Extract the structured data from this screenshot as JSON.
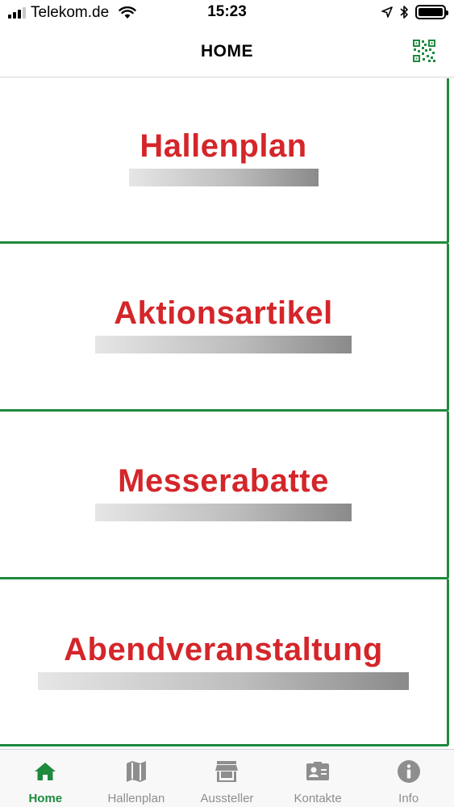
{
  "status_bar": {
    "carrier": "Telekom.de",
    "time": "15:23",
    "battery_level": 1.0
  },
  "nav": {
    "title": "HOME",
    "qr_icon": "qr-code-icon"
  },
  "colors": {
    "accent_green": "#1e8a3e",
    "tile_text_red": "#d4262a",
    "tab_inactive": "#8e8e8e"
  },
  "tiles": [
    {
      "label": "Hallenplan"
    },
    {
      "label": "Aktionsartikel"
    },
    {
      "label": "Messerabatte"
    },
    {
      "label": "Abendveranstaltung"
    }
  ],
  "tab_bar": {
    "tabs": [
      {
        "label": "Home",
        "icon": "home-icon",
        "active": true
      },
      {
        "label": "Hallenplan",
        "icon": "map-icon",
        "active": false
      },
      {
        "label": "Aussteller",
        "icon": "store-icon",
        "active": false
      },
      {
        "label": "Kontakte",
        "icon": "contact-card-icon",
        "active": false
      },
      {
        "label": "Info",
        "icon": "info-icon",
        "active": false
      }
    ]
  }
}
